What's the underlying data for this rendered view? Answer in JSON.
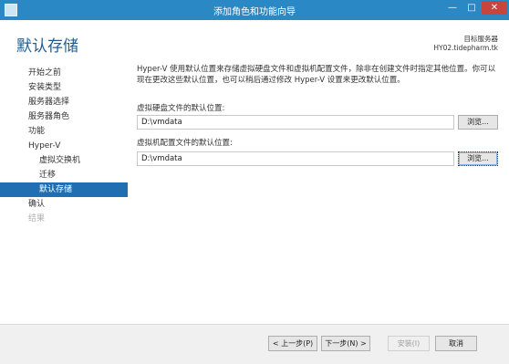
{
  "window": {
    "title": "添加角色和功能向导",
    "min_glyph": "—",
    "max_glyph": "□",
    "close_glyph": "✕"
  },
  "page": {
    "heading": "默认存储",
    "destination_label": "目标服务器",
    "destination_server": "HY02.tidepharm.tk"
  },
  "nav": {
    "items": [
      {
        "label": "开始之前",
        "state": "normal"
      },
      {
        "label": "安装类型",
        "state": "normal"
      },
      {
        "label": "服务器选择",
        "state": "normal"
      },
      {
        "label": "服务器角色",
        "state": "normal"
      },
      {
        "label": "功能",
        "state": "normal"
      },
      {
        "label": "Hyper-V",
        "state": "normal"
      },
      {
        "label": "虚拟交换机",
        "state": "sub"
      },
      {
        "label": "迁移",
        "state": "sub"
      },
      {
        "label": "默认存储",
        "state": "active"
      },
      {
        "label": "确认",
        "state": "normal"
      },
      {
        "label": "结果",
        "state": "disabled"
      }
    ]
  },
  "content": {
    "description": "Hyper-V 使用默认位置来存储虚拟硬盘文件和虚拟机配置文件，除非在创建文件时指定其他位置。你可以现在更改这些默认位置，也可以稍后通过修改 Hyper-V 设置来更改默认位置。",
    "vhd_label": "虚拟硬盘文件的默认位置:",
    "vhd_value": "D:\\vmdata",
    "vm_label": "虚拟机配置文件的默认位置:",
    "vm_value": "D:\\vmdata",
    "browse_label": "浏览..."
  },
  "footer": {
    "prev_label": "< 上一步(P)",
    "next_label": "下一步(N) >",
    "install_label": "安装(I)",
    "cancel_label": "取消"
  },
  "colors": {
    "titlebar": "#2a88c5",
    "active_nav": "#1f6fb2",
    "close_button": "#c7453b",
    "heading": "#1f5e95"
  }
}
